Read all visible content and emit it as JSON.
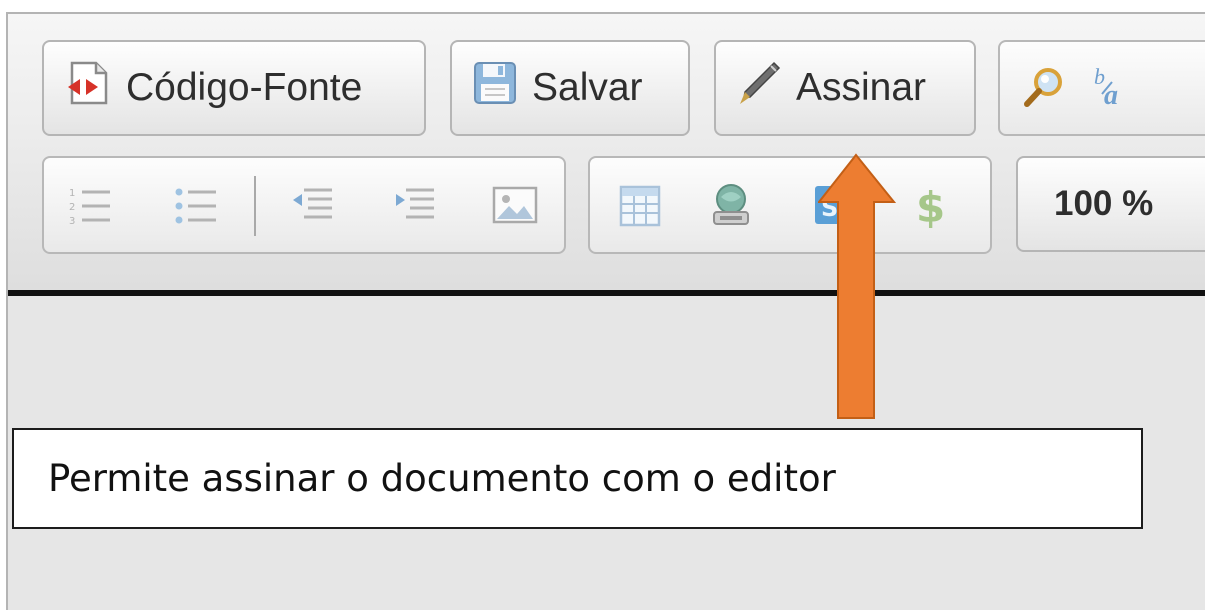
{
  "toolbar": {
    "row1": {
      "source_button": {
        "label": "Código-Fonte",
        "icon": "source-code-icon"
      },
      "save_button": {
        "label": "Salvar",
        "icon": "floppy-disk-icon"
      },
      "sign_button": {
        "label": "Assinar",
        "icon": "pen-icon"
      },
      "partial_group_icons": [
        "magnifier-icon",
        "spell-check-icon"
      ]
    },
    "row2": {
      "list_group_icons": [
        "numbered-list-icon",
        "bulleted-list-icon",
        "outdent-icon",
        "indent-icon",
        "image-icon"
      ],
      "insert_group_icons": [
        "table-icon",
        "stamp-icon",
        "symbol-icon",
        "dollar-icon"
      ],
      "zoom_value": "100 %"
    }
  },
  "annotation": {
    "caption": "Permite assinar o documento com o editor",
    "arrow_color": "#ED7D31"
  }
}
